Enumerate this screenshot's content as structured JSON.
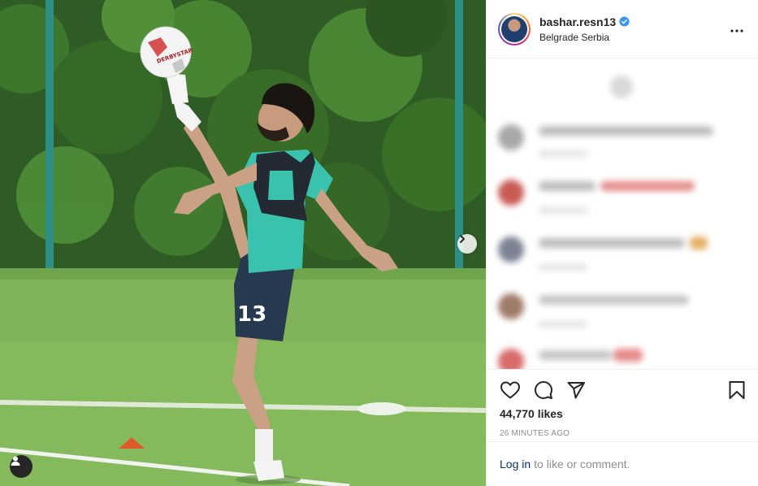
{
  "post": {
    "username": "bashar.resn13",
    "location": "Belgrade Serbia",
    "likes": "44,770 likes",
    "time_ago": "26 MINUTES AGO"
  },
  "icons": {
    "more": "more-options-icon",
    "verified": "verified-badge-icon",
    "like": "heart-icon",
    "comment": "comment-icon",
    "share": "paper-plane-icon",
    "save": "bookmark-icon",
    "next": "chevron-right-icon",
    "tags": "person-icon"
  },
  "login": {
    "link_text": "Log in",
    "rest_text": "to like or comment."
  },
  "player": {
    "shirt_number": "13",
    "ball_text": "DERBYSTAR"
  },
  "colors": {
    "link": "#00376b",
    "verified": "#3897f0",
    "muted": "#8e8e8e",
    "text": "#262626"
  }
}
